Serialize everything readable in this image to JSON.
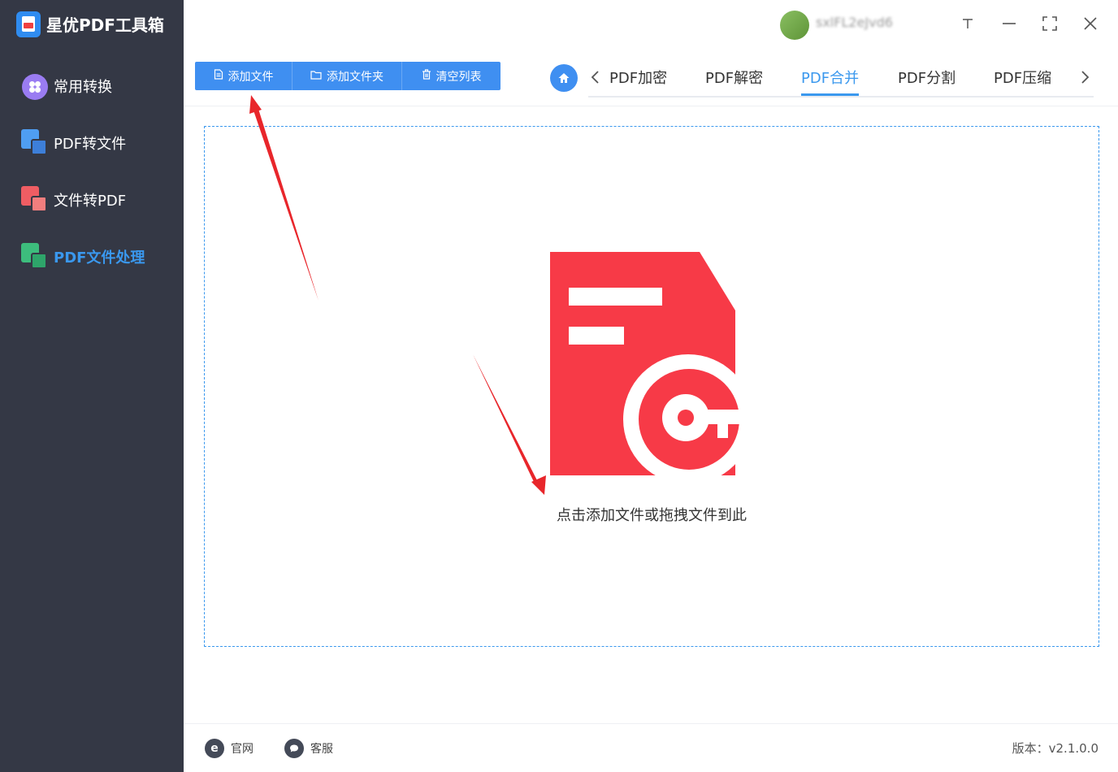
{
  "app": {
    "title": "星优PDF工具箱",
    "accent_color": "#3a98ee",
    "sidebar_color": "#343845",
    "logo_badge": "PDF"
  },
  "sidebar": {
    "items": [
      {
        "label": "常用转换",
        "icon": "apps-grid-icon",
        "color": "#9a7cf2",
        "active": false
      },
      {
        "label": "PDF转文件",
        "icon": "pdf-to-file-icon",
        "color": "#4f9ef2",
        "active": false
      },
      {
        "label": "文件转PDF",
        "icon": "file-to-pdf-icon",
        "color": "#ef5d63",
        "active": false
      },
      {
        "label": "PDF文件处理",
        "icon": "pdf-process-icon",
        "color": "#3dbd7d",
        "active": true
      }
    ]
  },
  "window": {
    "username": "sxlFL2eJvd6",
    "controls": [
      "pin-icon",
      "minimize-icon",
      "maximize-icon",
      "close-icon"
    ]
  },
  "toolbar": {
    "add_file": "添加文件",
    "add_folder": "添加文件夹",
    "clear_list": "清空列表"
  },
  "tabs": {
    "items": [
      "PDF加密",
      "PDF解密",
      "PDF合并",
      "PDF分割",
      "PDF压缩"
    ],
    "active": "PDF合并"
  },
  "dropzone": {
    "hint": "点击添加文件或拖拽文件到此",
    "illustration": "pdf-key-icon",
    "illustration_color": "#f73a47"
  },
  "footer": {
    "website": "官网",
    "support": "客服",
    "version": "版本：v2.1.0.0"
  }
}
